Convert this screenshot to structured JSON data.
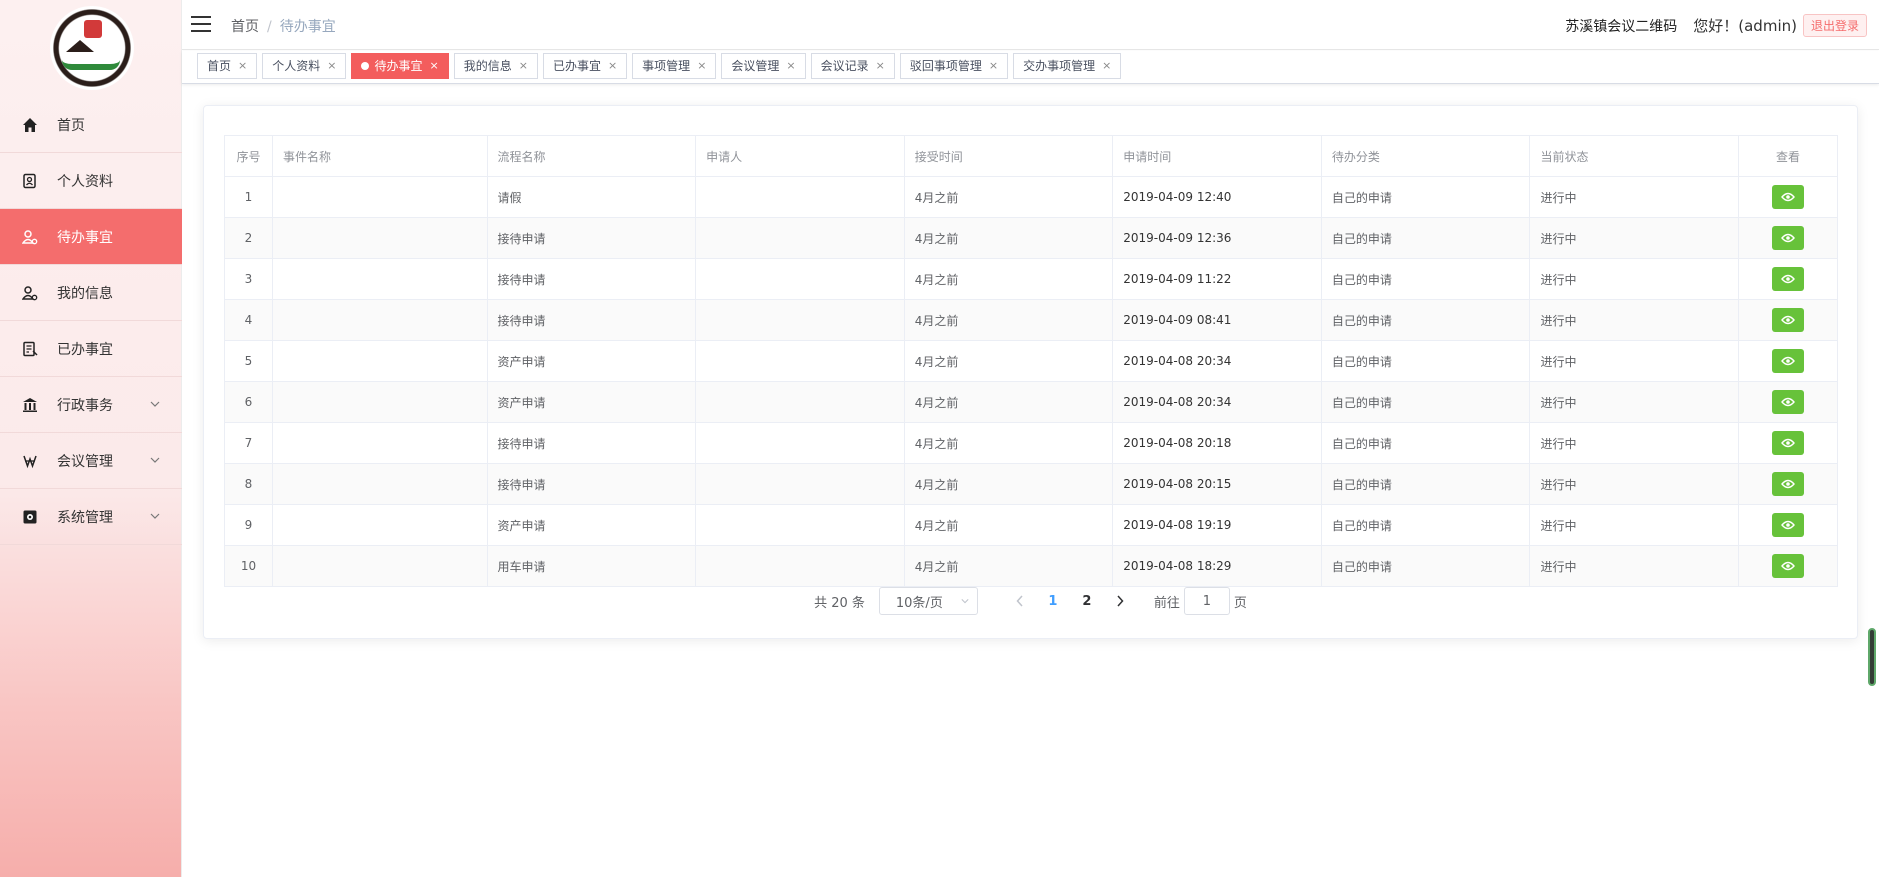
{
  "sidebar": {
    "items": [
      {
        "label": "首页",
        "icon": "home-icon"
      },
      {
        "label": "个人资料",
        "icon": "profile-icon"
      },
      {
        "label": "待办事宜",
        "icon": "todo-icon",
        "active": true
      },
      {
        "label": "我的信息",
        "icon": "user-info-icon"
      },
      {
        "label": "已办事宜",
        "icon": "done-icon"
      },
      {
        "label": "行政事务",
        "icon": "bank-icon",
        "expandable": true
      },
      {
        "label": "会议管理",
        "icon": "meeting-icon",
        "expandable": true
      },
      {
        "label": "系统管理",
        "icon": "settings-icon",
        "expandable": true
      }
    ]
  },
  "header": {
    "breadcrumb": [
      "首页",
      "/",
      "待办事宜"
    ],
    "qr_link": "苏溪镇会议二维码",
    "greeting": "您好！(admin)",
    "logout": "退出登录"
  },
  "tags": [
    {
      "label": "首页",
      "close": "×"
    },
    {
      "label": "个人资料",
      "close": "×"
    },
    {
      "label": "待办事宜",
      "close": "×",
      "active": true
    },
    {
      "label": "我的信息",
      "close": "×"
    },
    {
      "label": "已办事宜",
      "close": "×"
    },
    {
      "label": "事项管理",
      "close": "×"
    },
    {
      "label": "会议管理",
      "close": "×"
    },
    {
      "label": "会议记录",
      "close": "×"
    },
    {
      "label": "驳回事项管理",
      "close": "×"
    },
    {
      "label": "交办事项管理",
      "close": "×"
    }
  ],
  "table": {
    "headers": [
      "序号",
      "事件名称",
      "流程名称",
      "申请人",
      "接受时间",
      "申请时间",
      "待办分类",
      "当前状态",
      "查看"
    ],
    "rows": [
      {
        "seq": "1",
        "event": "",
        "flow": "请假",
        "applicant": "",
        "received": "4月之前",
        "applied": "2019-04-09 12:40",
        "category": "自己的申请",
        "status": "进行中"
      },
      {
        "seq": "2",
        "event": "",
        "flow": "接待申请",
        "applicant": "",
        "received": "4月之前",
        "applied": "2019-04-09 12:36",
        "category": "自己的申请",
        "status": "进行中"
      },
      {
        "seq": "3",
        "event": "",
        "flow": "接待申请",
        "applicant": "",
        "received": "4月之前",
        "applied": "2019-04-09 11:22",
        "category": "自己的申请",
        "status": "进行中"
      },
      {
        "seq": "4",
        "event": "",
        "flow": "接待申请",
        "applicant": "",
        "received": "4月之前",
        "applied": "2019-04-09 08:41",
        "category": "自己的申请",
        "status": "进行中"
      },
      {
        "seq": "5",
        "event": "",
        "flow": "资产申请",
        "applicant": "",
        "received": "4月之前",
        "applied": "2019-04-08 20:34",
        "category": "自己的申请",
        "status": "进行中"
      },
      {
        "seq": "6",
        "event": "",
        "flow": "资产申请",
        "applicant": "",
        "received": "4月之前",
        "applied": "2019-04-08 20:34",
        "category": "自己的申请",
        "status": "进行中"
      },
      {
        "seq": "7",
        "event": "",
        "flow": "接待申请",
        "applicant": "",
        "received": "4月之前",
        "applied": "2019-04-08 20:18",
        "category": "自己的申请",
        "status": "进行中"
      },
      {
        "seq": "8",
        "event": "",
        "flow": "接待申请",
        "applicant": "",
        "received": "4月之前",
        "applied": "2019-04-08 20:15",
        "category": "自己的申请",
        "status": "进行中"
      },
      {
        "seq": "9",
        "event": "",
        "flow": "资产申请",
        "applicant": "",
        "received": "4月之前",
        "applied": "2019-04-08 19:19",
        "category": "自己的申请",
        "status": "进行中"
      },
      {
        "seq": "10",
        "event": "",
        "flow": "用车申请",
        "applicant": "",
        "received": "4月之前",
        "applied": "2019-04-08 18:29",
        "category": "自己的申请",
        "status": "进行中"
      }
    ]
  },
  "pagination": {
    "total": "共 20 条",
    "page_size": "10条/页",
    "pages": [
      "1",
      "2"
    ],
    "current": "1",
    "goto_label": "前往",
    "goto_value": "1",
    "goto_suffix": "页"
  },
  "colors": {
    "accent": "#f46d6d",
    "view_button": "#67c23a",
    "current_page": "#409eff"
  }
}
